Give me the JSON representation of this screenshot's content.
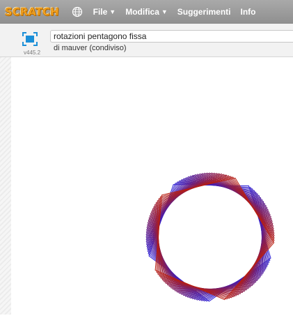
{
  "menubar": {
    "logo": "SCRATCH",
    "items": [
      {
        "label": "File",
        "has_arrow": true
      },
      {
        "label": "Modifica",
        "has_arrow": true
      },
      {
        "label": "Suggerimenti",
        "has_arrow": false
      },
      {
        "label": "Info",
        "has_arrow": false
      }
    ],
    "arrow_glyph": "▼",
    "icons": [
      "globe-icon"
    ]
  },
  "stage_header": {
    "project_title": "rotazioni pentagono fissa",
    "author_line": "di mauver (condiviso)",
    "version": "v445.2",
    "icons": [
      "fullscreen-icon"
    ]
  },
  "stage": {
    "drawing": {
      "shape": "pentagon",
      "copies": 28,
      "start_color": "#2b1ed6",
      "end_color": "#b81e10"
    }
  },
  "colors": {
    "menubar": "#9c9c9c",
    "logo_orange": "#f6a623",
    "fullscreen_blue": "#1b8fd8"
  }
}
